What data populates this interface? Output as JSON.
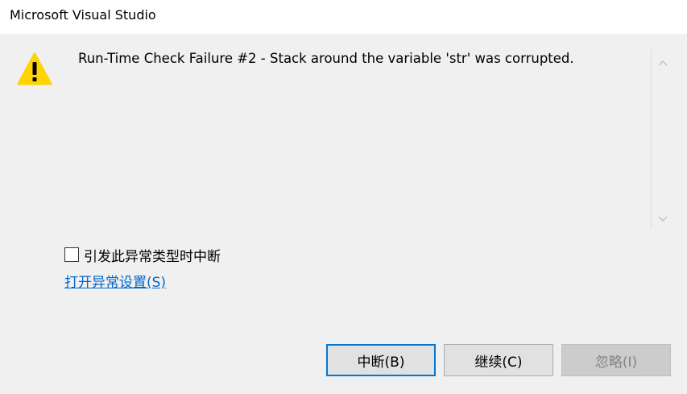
{
  "window": {
    "title": "Microsoft Visual Studio"
  },
  "message": {
    "icon": "warning-icon",
    "text": "Run-Time Check Failure #2 - Stack around the variable 'str' was corrupted."
  },
  "options": {
    "break_on_exception_label": "引发此异常类型时中断",
    "break_on_exception_checked": false,
    "open_settings_link": "打开异常设置(S)"
  },
  "buttons": {
    "break_label": "中断(B)",
    "continue_label": "继续(C)",
    "ignore_label": "忽略(I)",
    "ignore_enabled": false
  },
  "colors": {
    "dialog_background": "#f0f0f0",
    "titlebar_background": "#ffffff",
    "link": "#0066cc",
    "default_button_border": "#0078d7",
    "warning_fill": "#ffd400"
  }
}
